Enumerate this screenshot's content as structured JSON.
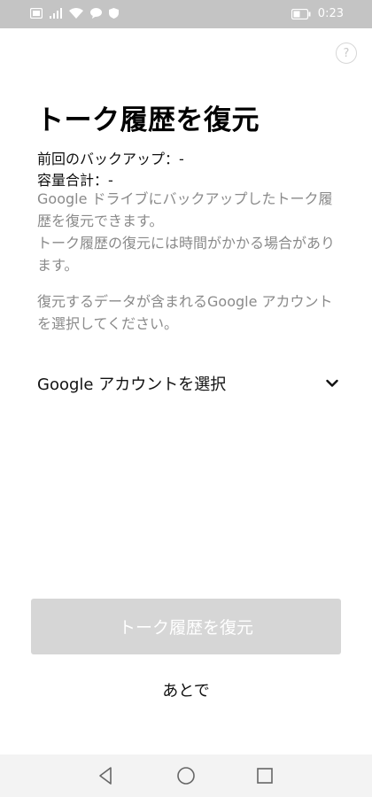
{
  "status_bar": {
    "time": "0:23"
  },
  "help": {
    "label": "?"
  },
  "title": "トーク履歴を復元",
  "backup_info": {
    "last_backup": "前回のバックアップ：-",
    "total_size": "容量合計：-"
  },
  "description": {
    "line1": "Google ドライブにバックアップしたトーク履歴を復元できます。",
    "line2": "トーク履歴の復元には時間がかかる場合があります。",
    "line3": "復元するデータが含まれるGoogle アカウントを選択してください。"
  },
  "account_select": {
    "label": "Google アカウントを選択"
  },
  "actions": {
    "restore_label": "トーク履歴を復元",
    "later_label": "あとで"
  },
  "colors": {
    "disabled_button": "#d6d6d6",
    "secondary_text": "#8a8a8a",
    "status_bar": "#c4c4c4"
  }
}
